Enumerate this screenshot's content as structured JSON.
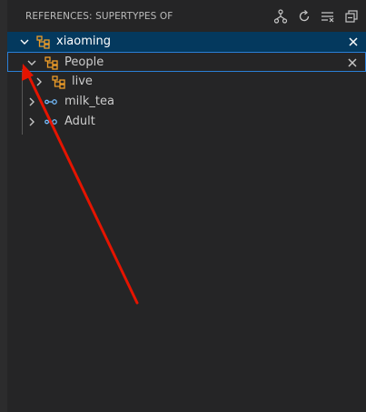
{
  "header": {
    "title": "REFERENCES: SUPERTYPES OF",
    "actions": [
      {
        "icon": "type-hierarchy-icon"
      },
      {
        "icon": "refresh-icon"
      },
      {
        "icon": "clear-icon"
      },
      {
        "icon": "collapse-all-icon"
      }
    ]
  },
  "tree": {
    "root": {
      "label": "xiaoming",
      "icon": "class-icon",
      "expanded": true,
      "selected": true
    },
    "items": [
      {
        "label": "People",
        "icon": "class-icon",
        "expanded": true
      },
      {
        "label": "live",
        "icon": "class-icon",
        "expanded": false
      },
      {
        "label": "milk_tea",
        "icon": "interface-icon",
        "expanded": false
      },
      {
        "label": "Adult",
        "icon": "interface-icon",
        "expanded": false
      }
    ]
  },
  "colors": {
    "background": "#252526",
    "selection": "#04395e",
    "focus_border": "#2b7fd6",
    "class_icon": "#ee9d28",
    "interface_icon": "#75beff",
    "annotation_arrow": "#e51400"
  }
}
